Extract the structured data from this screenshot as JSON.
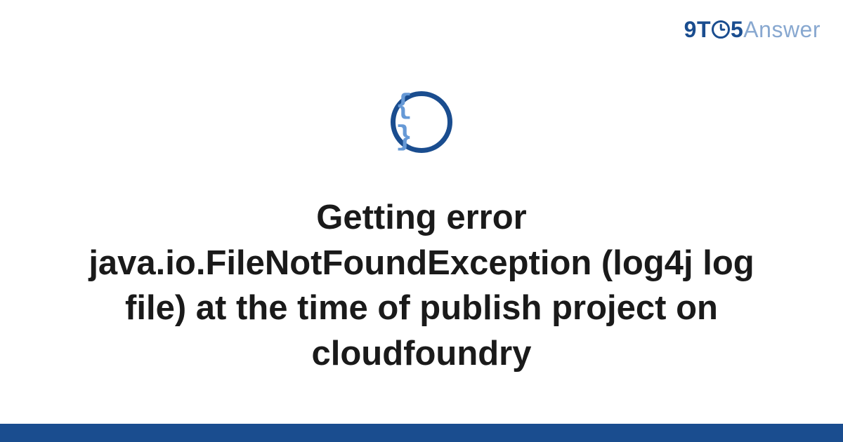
{
  "header": {
    "logo_9t": "9T",
    "logo_5": "5",
    "logo_answer": "Answer"
  },
  "icon": {
    "braces": "{ }",
    "semantic": "code-braces-icon"
  },
  "title": "Getting error java.io.FileNotFoundException (log4j log file) at the time of publish project on cloudfoundry",
  "colors": {
    "brand_dark": "#1a4d8f",
    "brand_light": "#88a8d0",
    "icon_brace": "#6699d6"
  }
}
